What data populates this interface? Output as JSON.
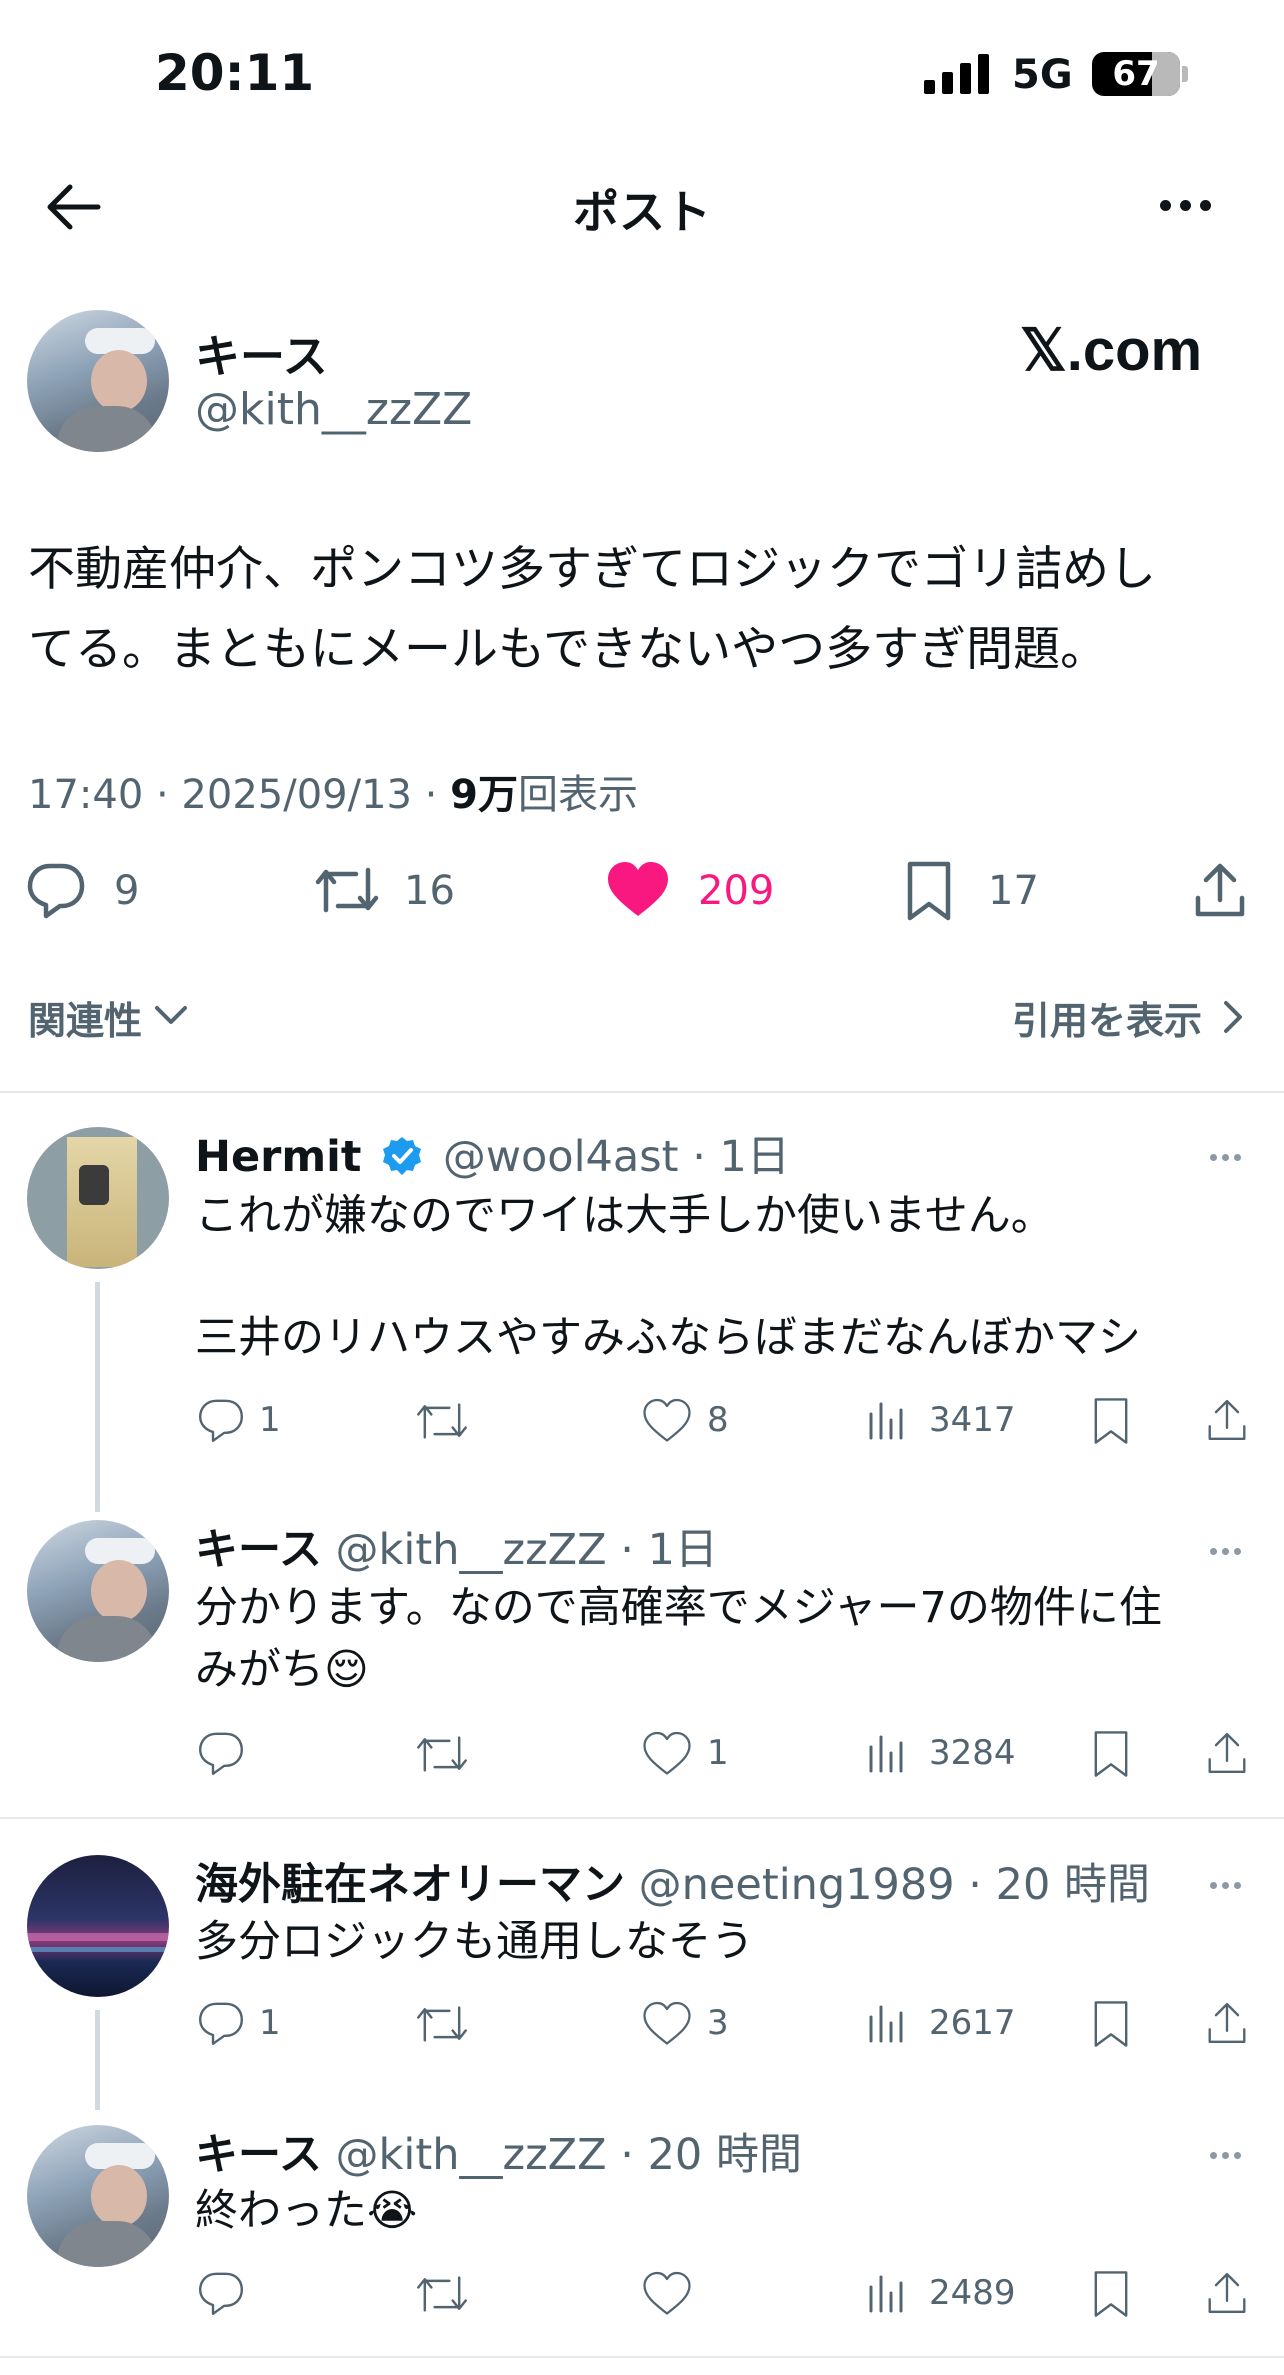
{
  "status_bar": {
    "time": "20:11",
    "network": "5G",
    "battery": "67"
  },
  "header": {
    "title": "ポスト"
  },
  "main_post": {
    "display_name": "キース",
    "handle": "@kith__zzZZ",
    "brand": "𝕏.com",
    "text_line1": "不動産仲介、ポンコツ多すぎてロジックでゴリ詰めし",
    "text_line2": "てる。まともにメールもできないやつ多すぎ問題。",
    "time": "17:40 · 2025/09/13 · ",
    "views_count": "9万",
    "views_label": "回表示",
    "replies": "9",
    "reposts": "16",
    "likes": "209",
    "bookmarks": "17",
    "related_label": "関連性",
    "quotes_label": "引用を表示"
  },
  "colors": {
    "like": "#f91880",
    "verified": "#1d9bf0",
    "secondary": "#536471"
  },
  "replies": [
    {
      "name": "Hermit",
      "verified": true,
      "handle": "@wool4ast",
      "time": "· 1日",
      "line1": "これが嫌なのでワイは大手しか使いません。",
      "line2": "三井のリハウスやすみふならばまだなんぼかマシ",
      "reply_count": "1",
      "like_count": "8",
      "views": "3417"
    },
    {
      "name": "キース",
      "handle": "@kith__zzZZ",
      "time": "· 1日",
      "line1": "分かります。なので高確率でメジャー7の物件に住",
      "line2": "みがち😌",
      "reply_count": "",
      "like_count": "1",
      "views": "3284"
    },
    {
      "name": "海外駐在ネオリーマン",
      "handle": "@neeting1989",
      "time": "· 20 時間",
      "line1": "多分ロジックも通用しなそう",
      "reply_count": "1",
      "like_count": "3",
      "views": "2617"
    },
    {
      "name": "キース",
      "handle": "@kith__zzZZ",
      "time": "· 20 時間",
      "line1": "終わった😭",
      "reply_count": "",
      "like_count": "",
      "views": "2489"
    }
  ]
}
